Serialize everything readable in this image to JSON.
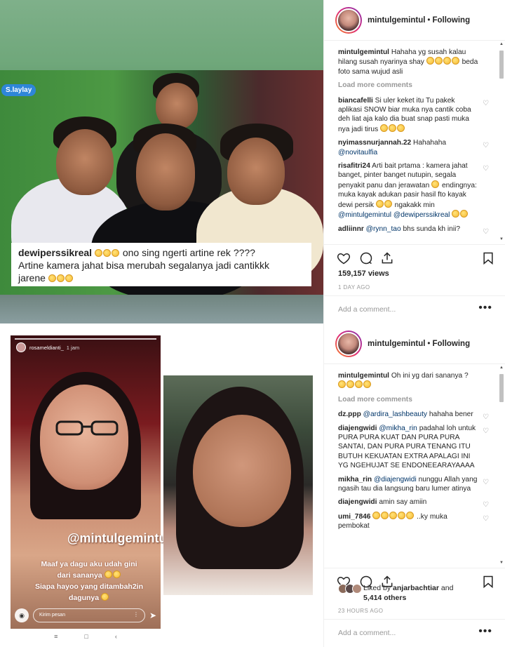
{
  "post1": {
    "header": {
      "username": "mintulgemintul",
      "separator": "•",
      "follow_label": "Following"
    },
    "media": {
      "badge": "S.laylay",
      "caption_user": "dewiperssikreal",
      "caption_line1": "ono sing ngerti artine rek ????",
      "caption_line2": "Artine kamera jahat bisa merubah segalanya jadi cantikkk",
      "caption_line3": "jarene"
    },
    "caption": {
      "user": "mintulgemintul",
      "text": "Hahaha yg susah kalau hilang susah nyarinya shay",
      "text2": "beda foto sama wujud asli"
    },
    "load_more": "Load more comments",
    "comments": [
      {
        "user": "biancafelli",
        "text": "Si uler keket itu Tu pakek aplikasi SNOW biar muka nya cantik coba deh liat aja kalo dia buat snap pasti muka nya jadi tirus"
      },
      {
        "user": "nyimassnurjannah.22",
        "text": "Hahahaha",
        "mention": "@novitaulfia"
      },
      {
        "user": "risafitri24",
        "text": "Arti bait prtama : kamera jahat banget, pinter banget nutupin, segala penyakit panu dan jerawatan",
        "text2": "endingnya: muka kayak adukan pasir hasil fto kayak dewi persik",
        "text3": "ngakakk min",
        "mention": "@mintulgemintul",
        "mention2": "@dewiperssikreal"
      },
      {
        "user": "adliinnr",
        "mention": "@rynn_tao",
        "text": "bhs sunda kh inii?"
      }
    ],
    "likes": "159,157 views",
    "time": "1 DAY AGO",
    "add_comment": "Add a comment..."
  },
  "post2": {
    "header": {
      "username": "mintulgemintul",
      "separator": "•",
      "follow_label": "Following"
    },
    "story": {
      "user": "rosameldianti_",
      "time": "1 jam",
      "handle": "@mintulgemintul",
      "line1": "Maaf ya dagu aku udah gini",
      "line2": "dari sananya",
      "line3": "Siapa hayoo yang ditambah2in",
      "line4": "dagunya",
      "input_placeholder": "Kirim pesan"
    },
    "caption": {
      "user": "mintulgemintul",
      "text": "Oh ini yg dari sananya ?"
    },
    "load_more": "Load more comments",
    "comments": [
      {
        "user": "dz.ppp",
        "mention": "@ardira_lashbeauty",
        "text": "hahaha bener"
      },
      {
        "user": "diajengwidi",
        "mention": "@mikha_rin",
        "text": "padahal loh untuk PURA PURA KUAT DAN PURA PURA SANTAI, DAN PURA PURA TENANG ITU BUTUH KEKUATAN EXTRA APALAGI INI YG NGEHUJAT SE ENDONEEARAYAAAA"
      },
      {
        "user": "mikha_rin",
        "mention": "@diajengwidi",
        "text": "nunggu Allah yang ngasih tau dia langsung baru lumer atinya"
      },
      {
        "user": "diajengwidi",
        "text": "amin say amiin"
      },
      {
        "user": "umi_7846",
        "text": "..ky muka pembokat"
      }
    ],
    "liked_by_prefix": "Liked by",
    "liked_by_user": "anjarbachtiar",
    "liked_by_and": "and",
    "liked_by_others": "5,414 others",
    "time": "23 HOURS AGO",
    "add_comment": "Add a comment..."
  },
  "colors": {
    "link": "#003569",
    "muted": "#999999",
    "text": "#262626"
  }
}
